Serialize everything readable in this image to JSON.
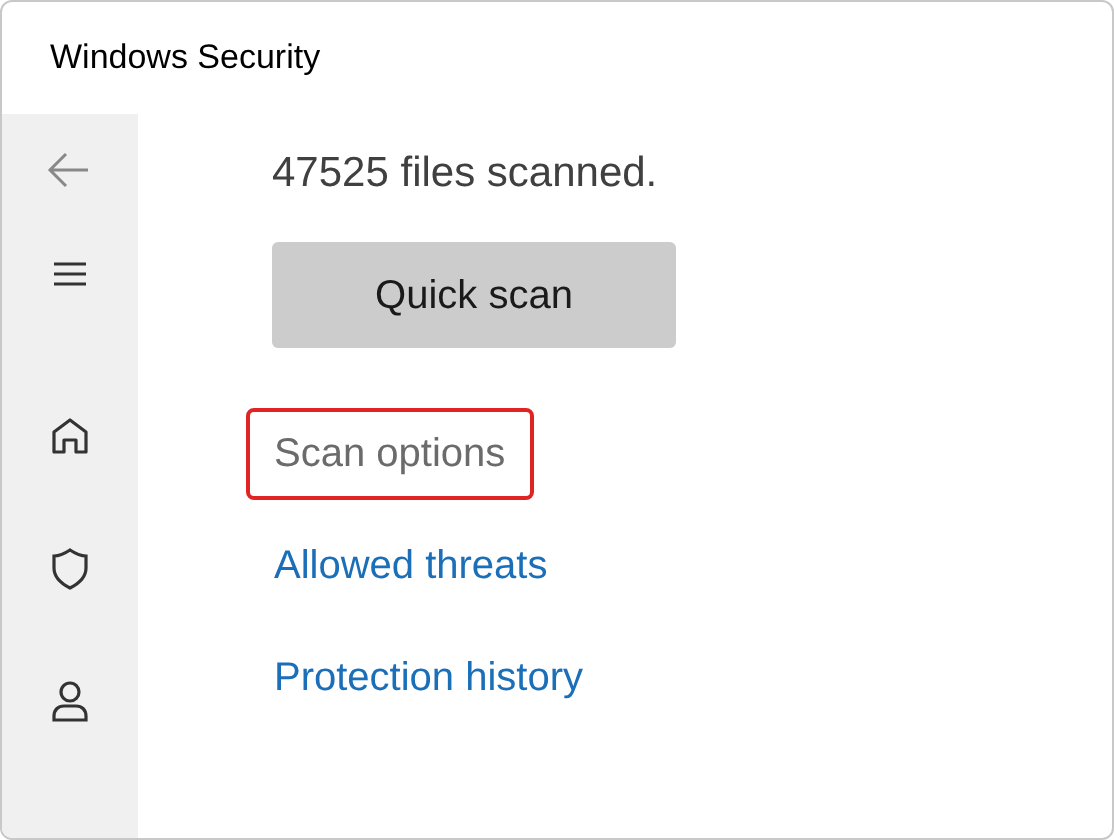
{
  "window": {
    "title": "Windows Security"
  },
  "sidebar": {
    "items": [
      {
        "kind": "back"
      },
      {
        "kind": "menu"
      },
      {
        "kind": "home"
      },
      {
        "kind": "shield"
      },
      {
        "kind": "account"
      }
    ]
  },
  "status": "47525 files scanned.",
  "scan_button": "Quick scan",
  "links": [
    {
      "label": "Scan options",
      "kind": "plain",
      "highlighted": true
    },
    {
      "label": "Allowed threats",
      "kind": "link",
      "highlighted": false
    },
    {
      "label": "Protection history",
      "kind": "link",
      "highlighted": false
    }
  ]
}
